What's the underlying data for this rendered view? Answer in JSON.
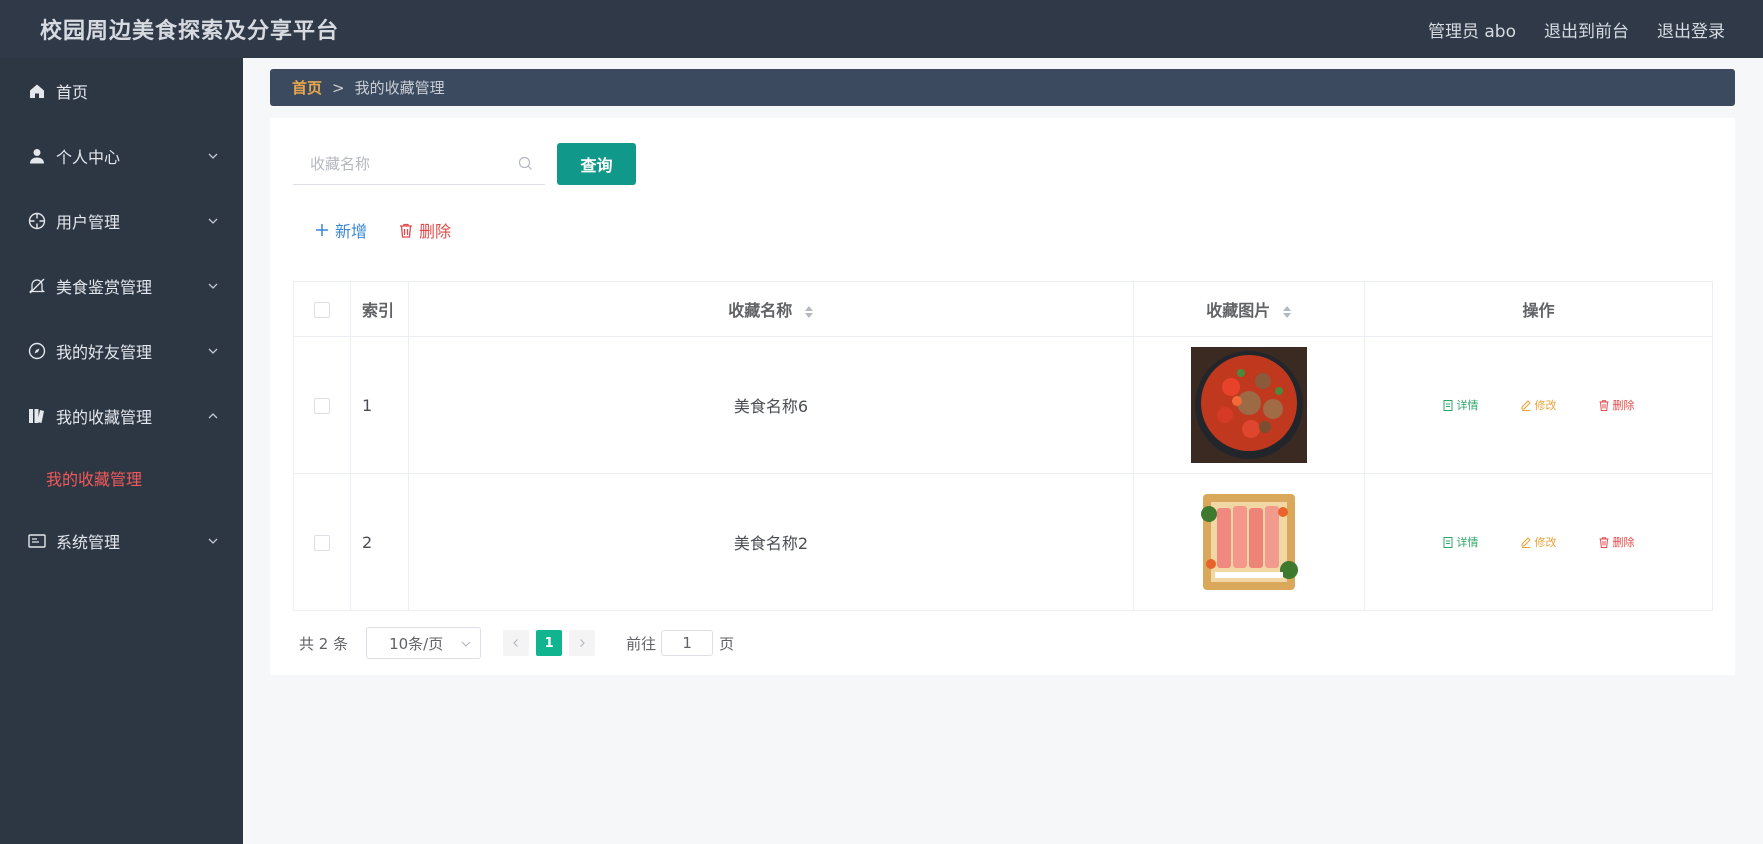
{
  "header": {
    "title": "校园周边美食探索及分享平台",
    "user_label": "管理员 abo",
    "back_to_front": "退出到前台",
    "logout": "退出登录"
  },
  "sidebar": {
    "items": [
      {
        "label": "首页",
        "icon": "home-icon"
      },
      {
        "label": "个人中心",
        "icon": "user-icon"
      },
      {
        "label": "用户管理",
        "icon": "crosshair-icon"
      },
      {
        "label": "美食鉴赏管理",
        "icon": "bell-off-icon"
      },
      {
        "label": "我的好友管理",
        "icon": "compass-icon"
      },
      {
        "label": "我的收藏管理",
        "icon": "collection-icon",
        "submenu": [
          "我的收藏管理"
        ]
      },
      {
        "label": "系统管理",
        "icon": "monitor-icon"
      }
    ]
  },
  "breadcrumb": {
    "home": "首页",
    "separator": ">",
    "current": "我的收藏管理"
  },
  "search": {
    "placeholder": "收藏名称",
    "button": "查询"
  },
  "actions": {
    "add": "新增",
    "delete": "删除"
  },
  "table": {
    "headers": {
      "index": "索引",
      "name": "收藏名称",
      "image": "收藏图片",
      "ops": "操作"
    },
    "rows": [
      {
        "index": "1",
        "name": "美食名称6",
        "image": "spicy-dish-image"
      },
      {
        "index": "2",
        "name": "美食名称2",
        "image": "sashimi-platter-image"
      }
    ],
    "op_labels": {
      "detail": "详情",
      "edit": "修改",
      "delete": "删除"
    }
  },
  "pagination": {
    "total": "共 2 条",
    "page_size": "10条/页",
    "current_page": "1",
    "goto_label": "前往",
    "goto_value": "1",
    "page_suffix": "页"
  },
  "colors": {
    "header_bg": "#2f3947",
    "sidebar_bg": "#2d3643",
    "accent_teal": "#10988a",
    "active_red": "#f05a5a",
    "breadcrumb_home": "#e8a64d"
  }
}
